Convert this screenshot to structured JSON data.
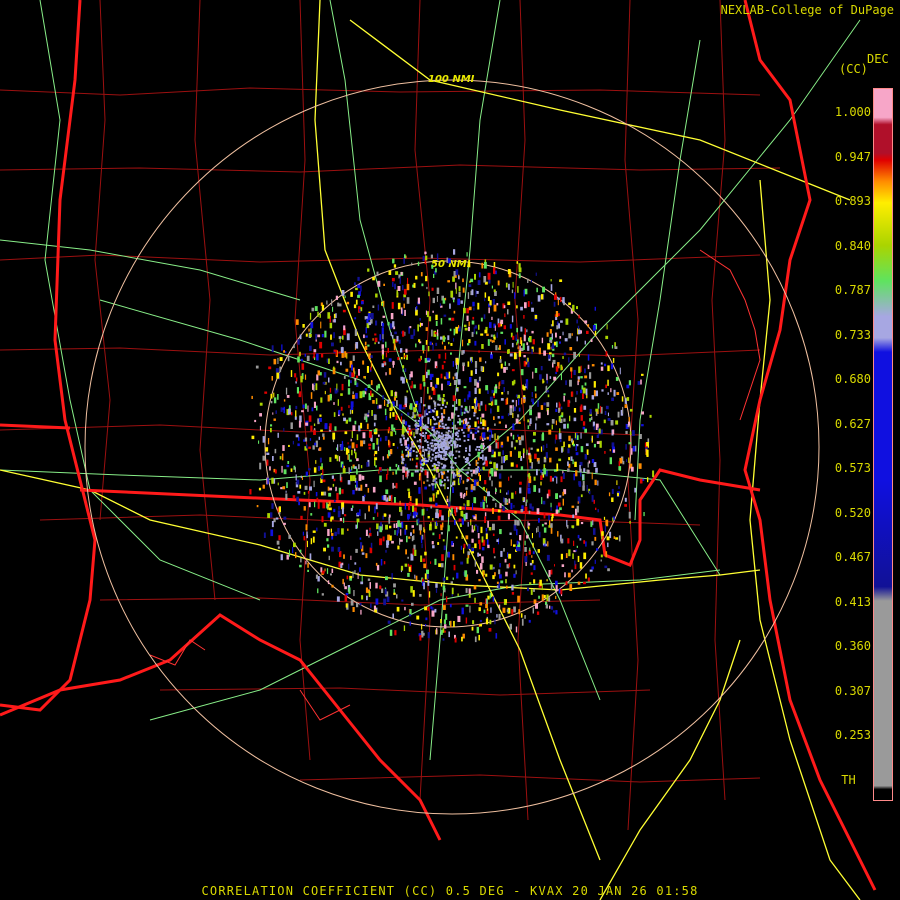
{
  "credit": "NEXLAB-College of DuPage",
  "legend": {
    "unit_top": "DEC",
    "unit": "(CC)",
    "labels": [
      "1.000",
      "0.947",
      "0.893",
      "0.840",
      "0.787",
      "0.733",
      "0.680",
      "0.627",
      "0.573",
      "0.520",
      "0.467",
      "0.413",
      "0.360",
      "0.307",
      "0.253",
      "TH"
    ],
    "colors": {
      "pink_top": "#f7a6c8",
      "dark_red": "#b0102a",
      "red": "#e00000",
      "orange": "#ff8c00",
      "yellow": "#ffee00",
      "lime": "#aad400",
      "green": "#5fe35f",
      "lavender": "#a7a7e2",
      "blue": "#1010e0",
      "navy": "#111196",
      "gray": "#9a9a9a",
      "black": "#000000"
    }
  },
  "range_rings": [
    {
      "label": "50 NMI"
    },
    {
      "label": "100 NMI"
    }
  ],
  "footer": "CORRELATION COEFFICIENT (CC) 0.5 DEG - KVAX 20 JAN 26 01:58",
  "map_colors": {
    "background": "#000000",
    "state_border": "#ff1a1a",
    "county": "#9c1010",
    "highway": "#ffff33",
    "road": "#88ee88",
    "ring": "#f0c0a0"
  }
}
